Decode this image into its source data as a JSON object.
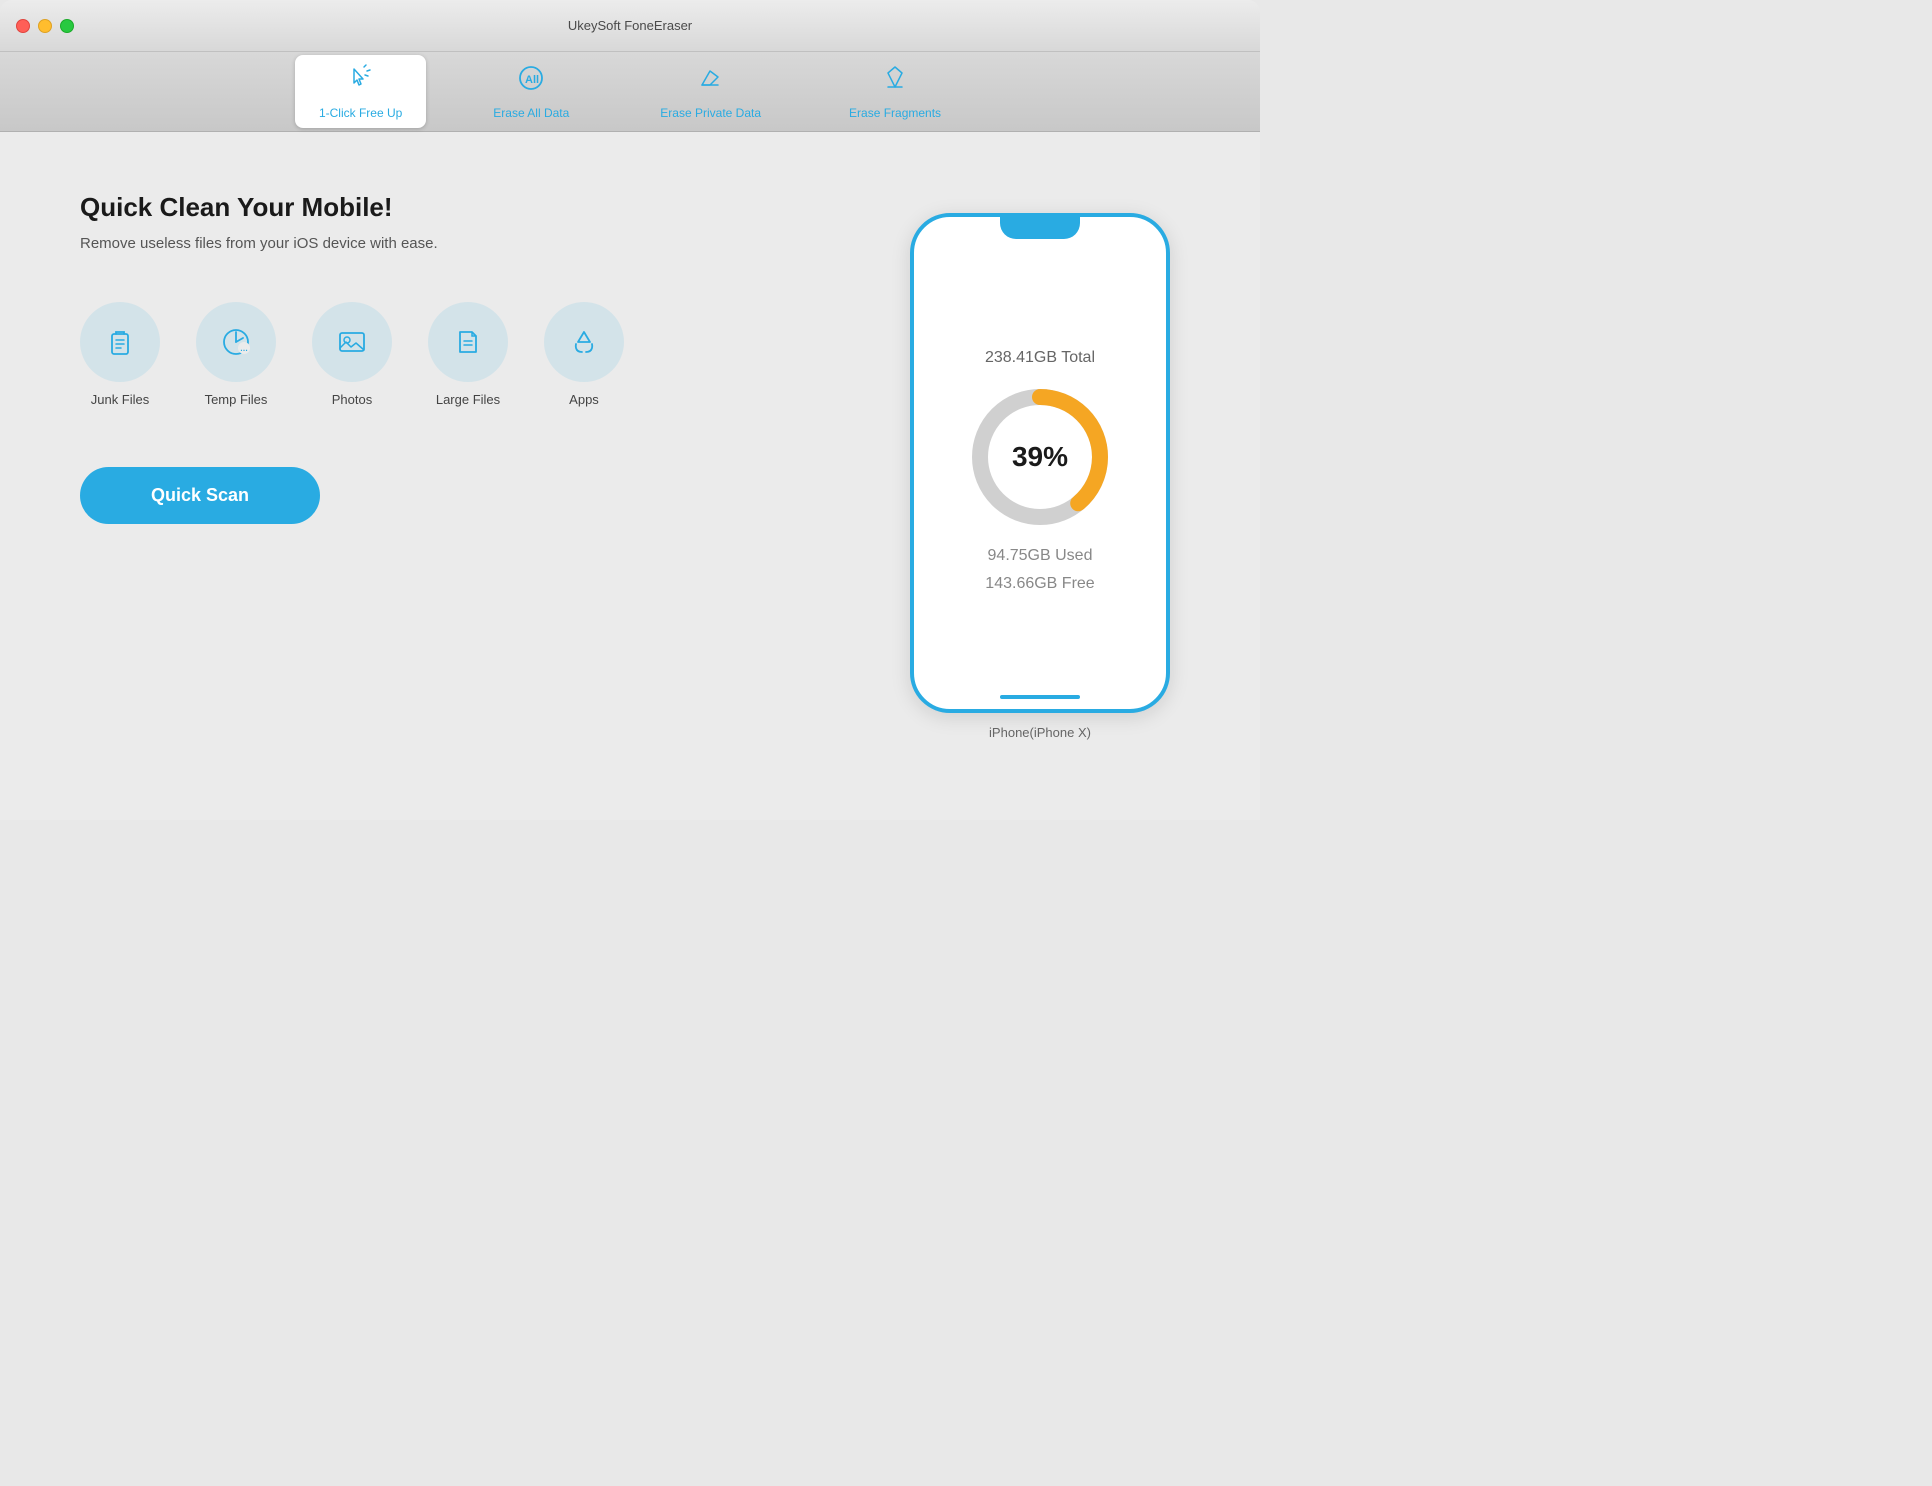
{
  "window": {
    "title": "UkeySoft FoneEraser"
  },
  "toolbar": {
    "tabs": [
      {
        "id": "one-click",
        "label": "1-Click Free Up",
        "active": true
      },
      {
        "id": "erase-all",
        "label": "Erase All Data",
        "active": false
      },
      {
        "id": "erase-private",
        "label": "Erase Private Data",
        "active": false
      },
      {
        "id": "erase-fragments",
        "label": "Erase Fragments",
        "active": false
      }
    ]
  },
  "main": {
    "headline": "Quick Clean Your Mobile!",
    "subheadline": "Remove useless files from your iOS device with ease.",
    "features": [
      {
        "id": "junk-files",
        "label": "Junk Files"
      },
      {
        "id": "temp-files",
        "label": "Temp Files"
      },
      {
        "id": "photos",
        "label": "Photos"
      },
      {
        "id": "large-files",
        "label": "Large Files"
      },
      {
        "id": "apps",
        "label": "Apps"
      }
    ],
    "quick_scan_label": "Quick Scan"
  },
  "device": {
    "name": "iPhone(iPhone X)",
    "storage_total": "238.41GB Total",
    "storage_used": "94.75GB Used",
    "storage_free": "143.66GB Free",
    "usage_percent": "39%",
    "usage_value": 39
  },
  "colors": {
    "blue": "#29abe2",
    "orange": "#f5a623",
    "gray_ring": "#d0d0d0"
  }
}
